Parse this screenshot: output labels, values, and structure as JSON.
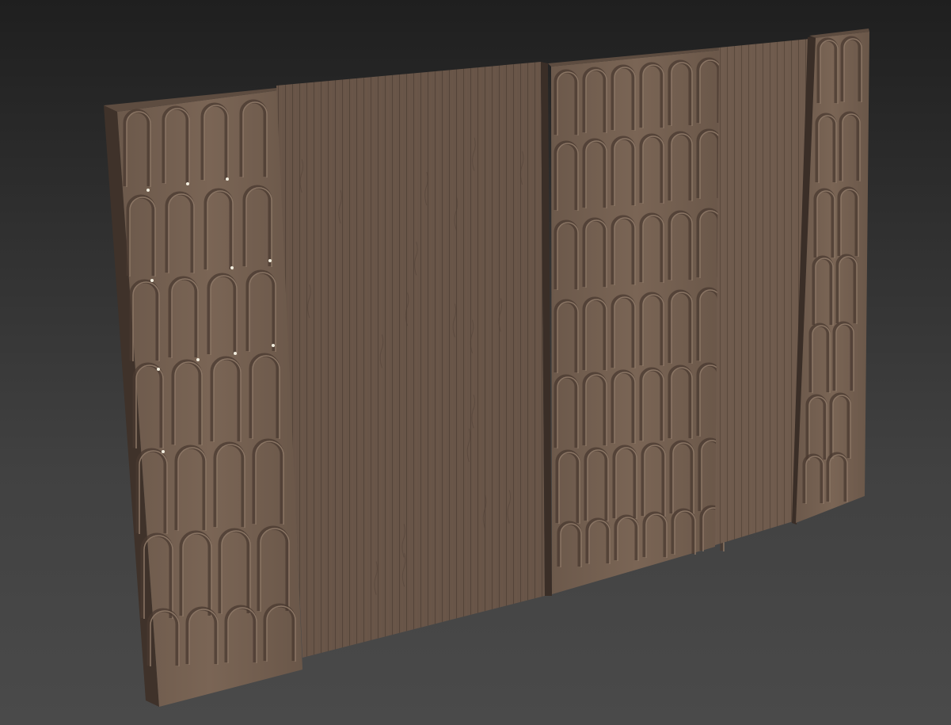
{
  "viewport": {
    "background_top": "#1f1f1f",
    "background_bottom": "#4a4a4a"
  },
  "model": {
    "material": "carved-wood-panels",
    "wood_base": "#6e5a4c",
    "wood_light": "#85705f",
    "wood_dark": "#4c3d33",
    "wood_edge": "#3e3129",
    "groove_line": "#5a4a3e",
    "highlight": "#f3efe0"
  }
}
